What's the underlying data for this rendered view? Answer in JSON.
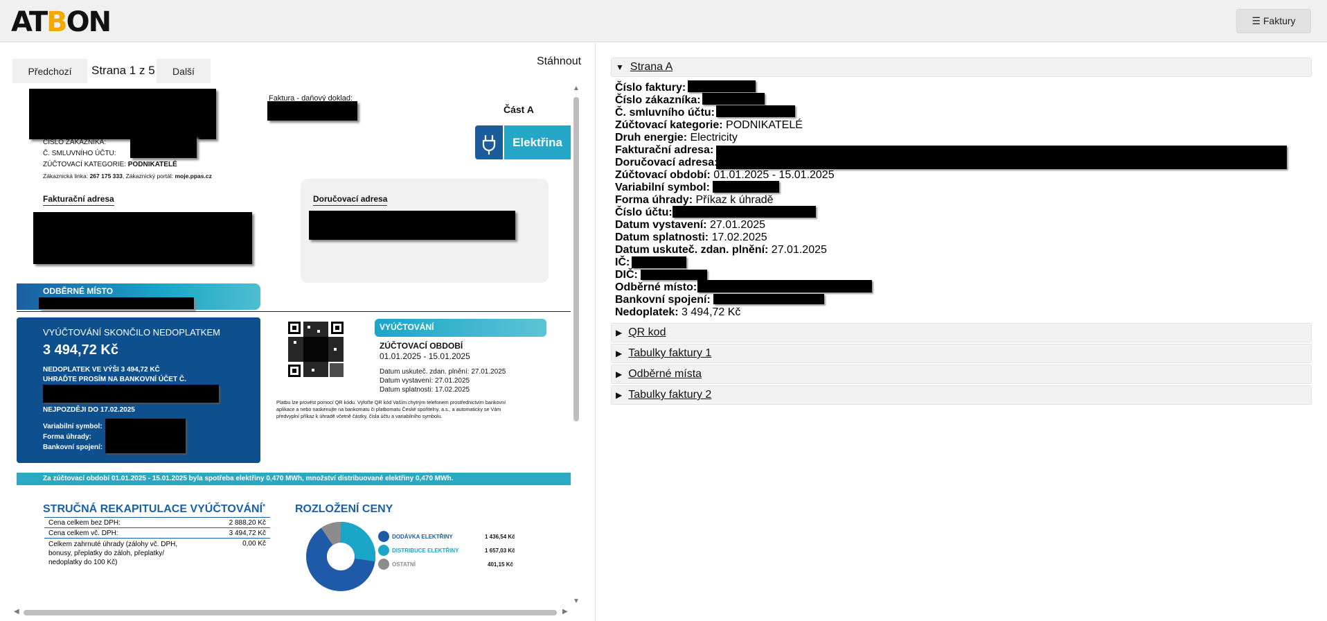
{
  "header": {
    "logo_parts": [
      "AT",
      "B",
      "O",
      "N"
    ],
    "invoices_button": "☰ Faktury"
  },
  "viewer": {
    "prev_label": "Předchozí",
    "page_indicator": "Strana 1 z 5",
    "next_label": "Další",
    "download_label": "Stáhnout"
  },
  "document": {
    "doc_type": "Faktura - daňový doklad:",
    "part": "Část A",
    "energy_badge": "Elektřina",
    "customer_number_label": "ČÍSLO ZÁKAZNÍKA:",
    "contract_account_label": "Č. SMLUVNÍHO ÚČTU:",
    "billing_category_label": "ZÚČTOVACÍ KATEGORIE:",
    "billing_category_value": "PODNIKATELÉ",
    "helpline_label": "Zákaznická linka:",
    "helpline_value": "267 175 333",
    "portal_label": ", Zákaznický portál:",
    "portal_value": "moje.ppas.cz",
    "billing_address_title": "Fakturační adresa",
    "delivery_address_title": "Doručovací adresa",
    "consumption_point_title": "ODBĚRNÉ MÍSTO",
    "settlement_title": "VYÚČTOVÁNÍ SKONČILO NEDOPLATKEM",
    "settlement_amount": "3 494,72 Kč",
    "underpayment_line1": "NEDOPLATEK VE VÝŠI 3 494,72 KČ",
    "underpayment_line2": "UHRAĎTE PROSÍM NA BANKOVNÍ ÚČET Č.",
    "deadline_label": "NEJPOZDĚJI DO",
    "deadline_value": "17.02.2025",
    "var_symbol_label": "Variabilní symbol:",
    "payment_method_label": "Forma úhrady:",
    "bank_label": "Bankovní spojení:",
    "billing_box_title": "VYÚČTOVÁNÍ",
    "billing_period_title": "ZÚČTOVACÍ OBDOBÍ",
    "billing_period_value": "01.01.2025 - 15.01.2025",
    "taxable_date_label": "Datum uskuteč. zdan. plnění:",
    "taxable_date_value": "27.01.2025",
    "issue_date_label": "Datum vystavení:",
    "issue_date_value": "27.01.2025",
    "due_date_label": "Datum splatnosti:",
    "due_date_value": "17.02.2025",
    "qr_text_1": "Platbu lze provést pomocí QR kódu. Vyfoťte QR kód Vaším chytrým telefonem prostřednictvím bankovní",
    "qr_text_2": "aplikace a nebo naskenujte na bankomatu či platbomatu České spořitelny, a.s., a automaticky se Vám",
    "qr_text_3": "předvyplní příkaz k úhradě včetně částky, čísla účtu a variabilního symbolu.",
    "consumption_banner": "Za zúčtovací období 01.01.2025 - 15.01.2025 byla spotřeba elektřiny 0,470 MWh, množství distribuované elektřiny 0,470 MWh.",
    "recap_title": "STRUČNÁ REKAPITULACE VYÚČTOVÁNÍ",
    "recap_asterisk": "*",
    "recap_rows": [
      {
        "label": "Cena celkem bez DPH:",
        "value": "2 888,20 Kč"
      },
      {
        "label": "Cena celkem vč. DPH:",
        "value": "3 494,72 Kč"
      },
      {
        "label": "Celkem zahrnuté úhrady (zálohy vč. DPH, bonusy, přeplatky do záloh, přeplatky/ nedoplatky do 100 Kč)",
        "value": "0,00 Kč"
      }
    ],
    "price_title": "ROZLOŽENÍ CENY",
    "price_legend": [
      {
        "label": "DODÁVKA ELEKTŘINY",
        "value": "1 436,54 Kč",
        "color": "#1e5aa8"
      },
      {
        "label": "DISTRIBUCE ELEKTŘINY",
        "value": "1 657,03 Kč",
        "color": "#1aa6c9"
      },
      {
        "label": "OSTATNÍ",
        "value": "401,15 Kč",
        "color": "#8c8c8c"
      }
    ]
  },
  "sections": {
    "strana_a": "Strana A",
    "qr": "QR kod",
    "tabulky1": "Tabulky faktury 1",
    "odberna": "Odběrné místa",
    "tabulky2": "Tabulky faktury 2"
  },
  "fields": {
    "cislo_faktury": "Číslo faktury:",
    "cislo_zakaznika": "Číslo zákazníka:",
    "c_smluvniho_uctu": "Č. smluvního účtu:",
    "zuctovaci_kategorie": "Zúčtovací kategorie:",
    "zuctovaci_kategorie_value": " PODNIKATELÉ",
    "druh_energie": "Druh energie:",
    "druh_energie_value": " Electricity",
    "fakturacni_adresa": "Fakturační adresa:",
    "dorucovaci_adresa": "Doručovací adresa:",
    "zuctovaci_obdobi": "Zúčtovací období:",
    "zuctovaci_obdobi_value": " 01.01.2025 - 15.01.2025",
    "variabilni_symbol": "Variabilní symbol:",
    "forma_uhrady": "Forma úhrady:",
    "forma_uhrady_value": " Příkaz k úhradě",
    "cislo_uctu": "Číslo účtu:",
    "datum_vystaveni": "Datum vystavení:",
    "datum_vystaveni_value": " 27.01.2025",
    "datum_splatnosti": "Datum splatnosti:",
    "datum_splatnosti_value": " 17.02.2025",
    "datum_uskutec": "Datum uskuteč. zdan. plnění:",
    "datum_uskutec_value": " 27.01.2025",
    "ic": "IČ:",
    "dic": "DIČ:",
    "odberne_misto": "Odběrné místo:",
    "bankovni_spojeni": "Bankovní spojení:",
    "nedoplatek": "Nedoplatek:",
    "nedoplatek_value": " 3 494,72 Kč"
  }
}
